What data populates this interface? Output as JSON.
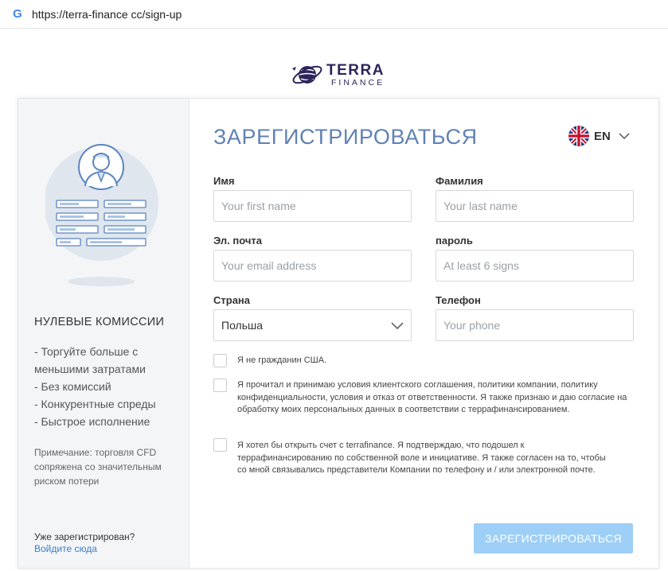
{
  "browser": {
    "url": "https://terra-finance cc/sign-up"
  },
  "logo": {
    "line1": "TERRA",
    "line2": "FINANCE"
  },
  "left_panel": {
    "title": "НУЛЕВЫЕ КОМИССИИ",
    "features": [
      "- Торгуйте больше с",
      "меньшими затратами",
      "- Без комиссий",
      "- Конкурентные спреды",
      "- Быстрое исполнение"
    ],
    "note": "Примечание: торговля CFD сопряжена со значительным риском потери",
    "already_registered": "Уже зарегистрирован?",
    "login_link": "Войдите сюда"
  },
  "form": {
    "title": "ЗАРЕГИСТРИРОВАТЬСЯ",
    "language": {
      "code": "EN",
      "icon": "uk-flag-icon"
    },
    "fields": {
      "first_name": {
        "label": "Имя",
        "placeholder": "Your first name",
        "value": ""
      },
      "last_name": {
        "label": "Фамилия",
        "placeholder": "Your last name",
        "value": ""
      },
      "email": {
        "label": "Эл. почта",
        "placeholder": "Your email address",
        "value": ""
      },
      "password": {
        "label": "пароль",
        "placeholder": "At least 6 signs",
        "value": ""
      },
      "country": {
        "label": "Страна",
        "value": "Польша"
      },
      "phone": {
        "label": "Телефон",
        "placeholder": "Your phone",
        "value": ""
      }
    },
    "checkboxes": [
      {
        "text": "Я не гражданин США.",
        "checked": false
      },
      {
        "text": "Я прочитал и принимаю условия клиентского соглашения, политики компании, политику конфиденциальности, условия и отказ от ответственности. Я также признаю и даю согласие на обработку моих персональных данных в соответствии с террафинансированием.",
        "checked": false
      },
      {
        "text": "Я хотел бы открыть счет с terrafinance. Я подтверждаю, что подошел к террафинансированию по собственной воле и инициативе. Я также согласен на то, чтобы со мной связывались представители Компании по телефону и / или электронной почте.",
        "checked": false
      }
    ],
    "submit_label": "ЗАРЕГИСТРИРОВАТЬСЯ"
  },
  "colors": {
    "title_blue": "#5f82b4",
    "submit_bg": "#9dcff7",
    "link": "#3a7dc7",
    "brand_dark": "#2d2459"
  }
}
